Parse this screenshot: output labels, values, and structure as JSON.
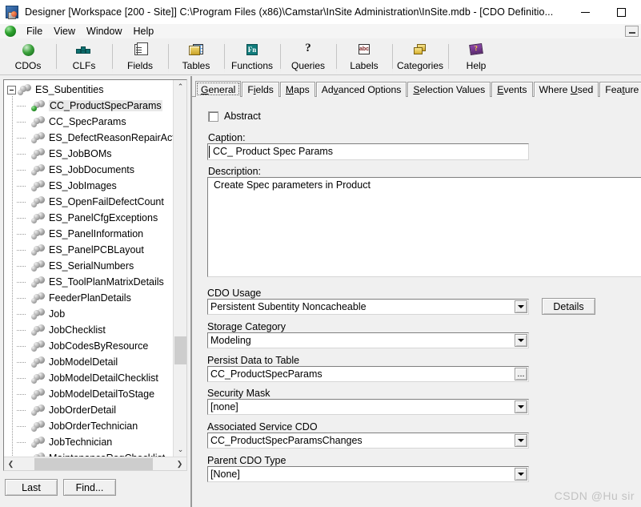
{
  "window": {
    "title": "Designer [Workspace [200 - Site]]  C:\\Program Files (x86)\\Camstar\\InSite Administration\\InSite.mdb - [CDO Definitio...",
    "icon": "designer-app-icon",
    "minimize_label": "Minimize",
    "maximize_label": "Maximize",
    "mdi_minimize_label": "Minimize Child Window"
  },
  "menu": {
    "orb_icon": "green-orb-icon",
    "items": [
      {
        "label": "File"
      },
      {
        "label": "View"
      },
      {
        "label": "Window"
      },
      {
        "label": "Help"
      }
    ]
  },
  "toolbar": {
    "buttons": [
      {
        "label": "CDOs",
        "icon": "green-sphere-icon"
      },
      {
        "label": "CLFs",
        "icon": "teal-blocks-icon"
      },
      {
        "label": "Fields",
        "icon": "documents-icon"
      },
      {
        "label": "Tables",
        "icon": "table-grid-icon"
      },
      {
        "label": "Functions",
        "icon": "function-fn-icon"
      },
      {
        "label": "Queries",
        "icon": "question-mark-icon"
      },
      {
        "label": "Labels",
        "icon": "abc-label-icon"
      },
      {
        "label": "Categories",
        "icon": "folders-icon"
      },
      {
        "label": "Help",
        "icon": "purple-book-icon"
      }
    ]
  },
  "tree": {
    "root": {
      "label": "ES_Subentities",
      "expanded": true,
      "icon": "cdo-spheres-icon"
    },
    "children": [
      {
        "label": "CC_ProductSpecParams",
        "selected": true,
        "icon": "cdo-spheres-green-icon"
      },
      {
        "label": "CC_SpecParams",
        "selected": false,
        "icon": "cdo-spheres-icon"
      },
      {
        "label": "ES_DefectReasonRepairActio",
        "selected": false,
        "icon": "cdo-spheres-icon"
      },
      {
        "label": "ES_JobBOMs",
        "selected": false,
        "icon": "cdo-spheres-icon"
      },
      {
        "label": "ES_JobDocuments",
        "selected": false,
        "icon": "cdo-spheres-icon"
      },
      {
        "label": "ES_JobImages",
        "selected": false,
        "icon": "cdo-spheres-icon"
      },
      {
        "label": "ES_OpenFailDefectCount",
        "selected": false,
        "icon": "cdo-spheres-icon"
      },
      {
        "label": "ES_PanelCfgExceptions",
        "selected": false,
        "icon": "cdo-spheres-icon"
      },
      {
        "label": "ES_PanelInformation",
        "selected": false,
        "icon": "cdo-spheres-icon"
      },
      {
        "label": "ES_PanelPCBLayout",
        "selected": false,
        "icon": "cdo-spheres-icon"
      },
      {
        "label": "ES_SerialNumbers",
        "selected": false,
        "icon": "cdo-spheres-icon"
      },
      {
        "label": "ES_ToolPlanMatrixDetails",
        "selected": false,
        "icon": "cdo-spheres-icon"
      },
      {
        "label": "FeederPlanDetails",
        "selected": false,
        "icon": "cdo-spheres-icon"
      },
      {
        "label": "Job",
        "selected": false,
        "icon": "cdo-spheres-icon"
      },
      {
        "label": "JobChecklist",
        "selected": false,
        "icon": "cdo-spheres-icon"
      },
      {
        "label": "JobCodesByResource",
        "selected": false,
        "icon": "cdo-spheres-icon"
      },
      {
        "label": "JobModelDetail",
        "selected": false,
        "icon": "cdo-spheres-icon"
      },
      {
        "label": "JobModelDetailChecklist",
        "selected": false,
        "icon": "cdo-spheres-icon"
      },
      {
        "label": "JobModelDetailToStage",
        "selected": false,
        "icon": "cdo-spheres-icon"
      },
      {
        "label": "JobOrderDetail",
        "selected": false,
        "icon": "cdo-spheres-icon"
      },
      {
        "label": "JobOrderTechnician",
        "selected": false,
        "icon": "cdo-spheres-icon"
      },
      {
        "label": "JobTechnician",
        "selected": false,
        "icon": "cdo-spheres-icon"
      },
      {
        "label": "MaintenanceReqChecklist",
        "selected": false,
        "icon": "cdo-spheres-icon"
      }
    ],
    "buttons": [
      {
        "label": "Last"
      },
      {
        "label": "Find..."
      }
    ],
    "scrollbar": {
      "up_arrow": "⌃",
      "down_arrow": "⌄",
      "left_arrow": "❮",
      "right_arrow": "❯"
    }
  },
  "tabs": [
    {
      "label": "General",
      "accel": "G",
      "active": true
    },
    {
      "label": "Fields",
      "accel": "i",
      "active": false
    },
    {
      "label": "Maps",
      "accel": "M",
      "active": false
    },
    {
      "label": "Advanced Options",
      "accel": "v",
      "active": false
    },
    {
      "label": "Selection Values",
      "accel": "S",
      "active": false
    },
    {
      "label": "Events",
      "accel": "E",
      "active": false
    },
    {
      "label": "Where Used",
      "accel": "U",
      "active": false
    },
    {
      "label": "Feature Entitlement",
      "accel": "t",
      "active": false
    }
  ],
  "general": {
    "abstract_label": "Abstract",
    "abstract_checked": false,
    "caption_label": "Caption:",
    "caption_value": "CC_ Product Spec Params",
    "description_label": "Description:",
    "description_value": "Create Spec parameters in Product",
    "cdo_usage_label": "CDO Usage",
    "cdo_usage_value": "Persistent Subentity Noncacheable",
    "details_button": "Details",
    "storage_category_label": "Storage Category",
    "storage_category_value": "Modeling",
    "persist_table_label": "Persist Data to Table",
    "persist_table_value": "CC_ProductSpecParams",
    "persist_table_browse": "...",
    "security_mask_label": "Security Mask",
    "security_mask_value": "[none]",
    "assoc_service_label": "Associated Service CDO",
    "assoc_service_value": "CC_ProductSpecParamsChanges",
    "parent_cdo_label": "Parent CDO Type",
    "parent_cdo_value": "[None]"
  },
  "watermark": "CSDN @Hu  sir"
}
